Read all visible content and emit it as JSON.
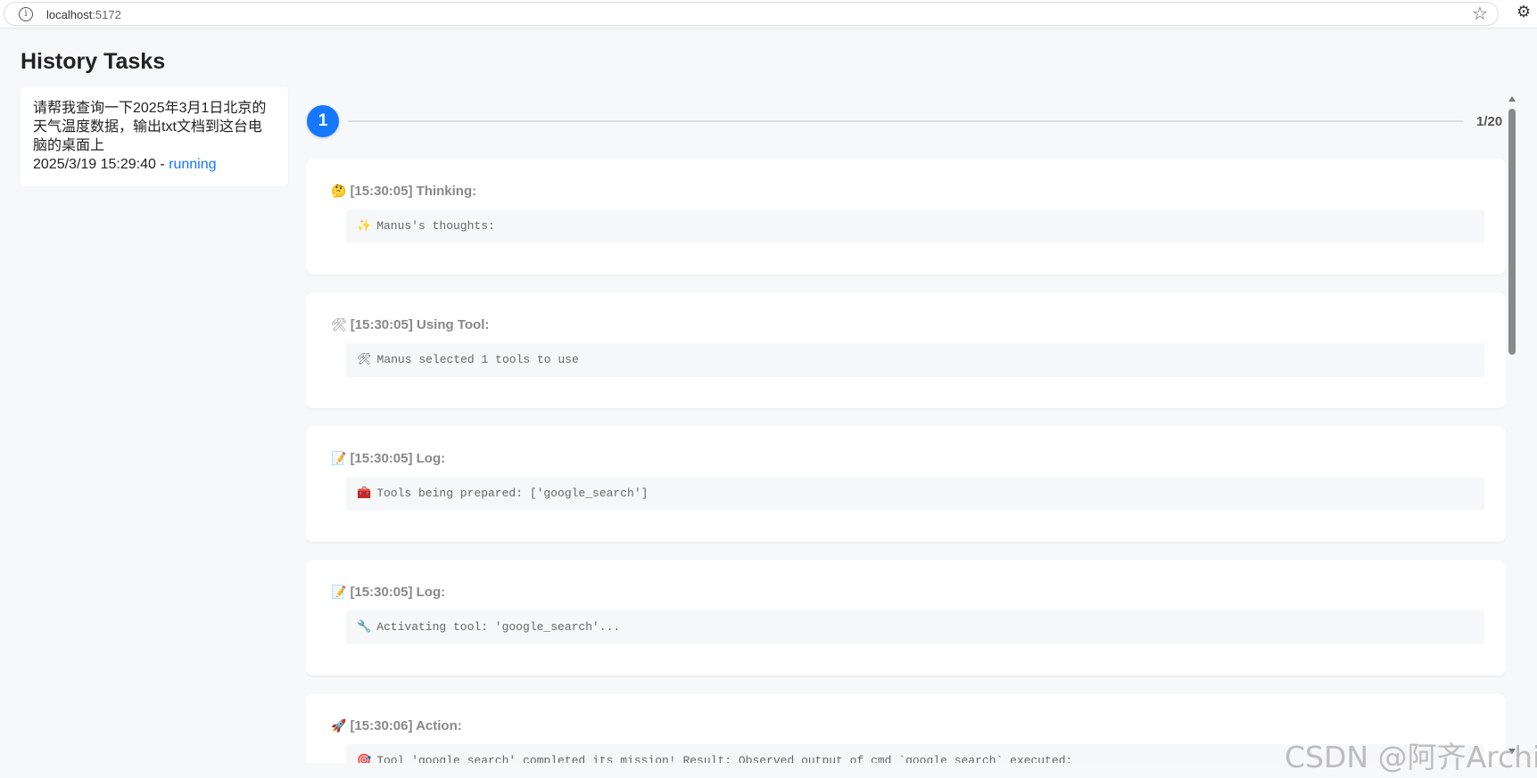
{
  "browser": {
    "url_host": "localhost",
    "url_port": ":5172",
    "info_icon": "ⓘ",
    "star_icon": "☆",
    "extension_icon": "⚙"
  },
  "sidebar": {
    "title": "History Tasks",
    "tasks": [
      {
        "text": "请帮我查询一下2025年3月1日北京的天气温度数据，输出txt文档到这台电脑的桌面上",
        "datetime": "2025/3/19 15:29:40",
        "separator": " - ",
        "status": "running",
        "status_color": "#1677ff"
      }
    ]
  },
  "stepper": {
    "current": "1",
    "counter": "1/20",
    "accent": "#1677ff"
  },
  "logs": [
    {
      "emoji": "🤔",
      "header": "[15:30:05] Thinking:",
      "body_emoji": "✨",
      "body": "Manus's thoughts:"
    },
    {
      "emoji": "🛠",
      "header": "[15:30:05] Using Tool:",
      "body_emoji": "🛠",
      "body": "Manus selected 1 tools to use"
    },
    {
      "emoji": "📝",
      "header": "[15:30:05] Log:",
      "body_emoji": "🧰",
      "body": "Tools being prepared: ['google_search']"
    },
    {
      "emoji": "📝",
      "header": "[15:30:05] Log:",
      "body_emoji": "🔧",
      "body": "Activating tool: 'google_search'..."
    },
    {
      "emoji": "🚀",
      "header": "[15:30:06] Action:",
      "body_emoji": "🎯",
      "body": "Tool 'google_search' completed its mission! Result: Observed output of cmd `google_search` executed:"
    }
  ],
  "watermark": "CSDN @阿齐Archie"
}
